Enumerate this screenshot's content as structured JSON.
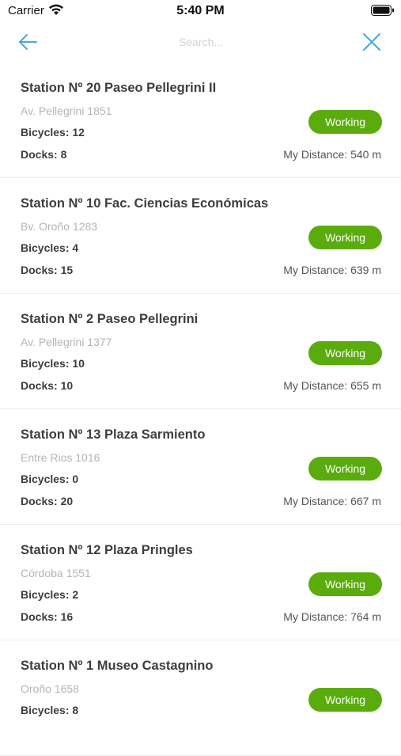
{
  "status_bar": {
    "carrier": "Carrier",
    "time": "5:40 PM",
    "icons": [
      "wifi-icon",
      "battery-icon"
    ]
  },
  "nav": {
    "back_icon": "arrow-left-icon",
    "search_placeholder": "Search...",
    "close_icon": "close-x-icon",
    "accent_color": "#4aa8d8"
  },
  "colors": {
    "working_pill": "#5aac0c",
    "address_text": "#b4b4b4"
  },
  "stations": [
    {
      "name": "Station Nº 20 Paseo Pellegrini II",
      "address": "Av. Pellegrini 1851",
      "bicycles": "Bicycles: 12",
      "docks": "Docks: 8",
      "status": "Working",
      "distance": "My Distance: 540 m"
    },
    {
      "name": "Station Nº 10 Fac. Ciencias Económicas",
      "address": "Bv. Oroño 1283",
      "bicycles": "Bicycles: 4",
      "docks": "Docks: 15",
      "status": "Working",
      "distance": "My Distance: 639 m"
    },
    {
      "name": "Station Nº 2 Paseo Pellegrini",
      "address": "Av. Pellegrini 1377",
      "bicycles": "Bicycles: 10",
      "docks": "Docks: 10",
      "status": "Working",
      "distance": "My Distance: 655 m"
    },
    {
      "name": "Station Nº 13 Plaza Sarmiento",
      "address": "Entre Rios 1016",
      "bicycles": "Bicycles: 0",
      "docks": "Docks: 20",
      "status": "Working",
      "distance": "My Distance: 667 m"
    },
    {
      "name": "Station Nº 12 Plaza Pringles",
      "address": "Córdoba 1551",
      "bicycles": "Bicycles: 2",
      "docks": "Docks: 16",
      "status": "Working",
      "distance": "My Distance: 764 m"
    },
    {
      "name": "Station Nº 1 Museo Castagnino",
      "address": "Oroño 1658",
      "bicycles": "Bicycles: 8",
      "docks": "",
      "status": "Working",
      "distance": ""
    }
  ]
}
